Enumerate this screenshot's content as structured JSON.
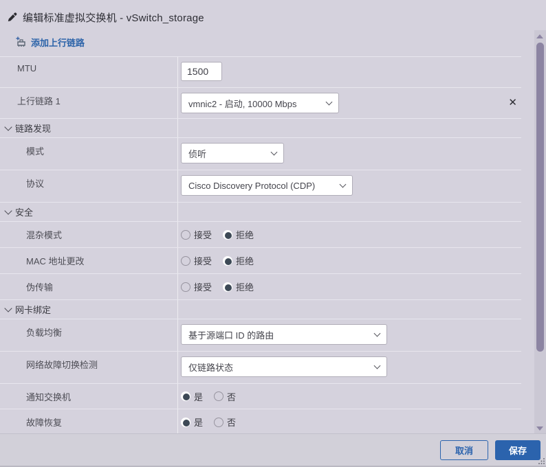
{
  "title_bar": {
    "title": "编辑标准虚拟交换机 - vSwitch_storage"
  },
  "toolbar": {
    "add_uplink_label": "添加上行链路"
  },
  "sections": {
    "link_discovery": "链路发现",
    "security": "安全",
    "nic_teaming": "网卡绑定"
  },
  "rows": {
    "mtu": {
      "label": "MTU",
      "value": "1500"
    },
    "uplink1": {
      "label": "上行链路 1",
      "value": "vmnic2 - 启动, 10000 Mbps"
    },
    "mode": {
      "label": "模式",
      "value": "侦听"
    },
    "protocol": {
      "label": "协议",
      "value": "Cisco Discovery Protocol (CDP)"
    },
    "promiscuous": {
      "label": "混杂模式",
      "accept": "接受",
      "reject": "拒绝",
      "selected": "拒绝"
    },
    "mac_changes": {
      "label": "MAC 地址更改",
      "accept": "接受",
      "reject": "拒绝",
      "selected": "拒绝"
    },
    "forged_transmits": {
      "label": "伪传输",
      "accept": "接受",
      "reject": "拒绝",
      "selected": "拒绝"
    },
    "load_balancing": {
      "label": "负载均衡",
      "value": "基于源端口 ID 的路由"
    },
    "failover_detection": {
      "label": "网络故障切换检测",
      "value": "仅链路状态"
    },
    "notify_switches": {
      "label": "通知交换机",
      "yes": "是",
      "no": "否",
      "selected": "是"
    },
    "failback": {
      "label": "故障恢复",
      "yes": "是",
      "no": "否",
      "selected": "是"
    }
  },
  "footer": {
    "cancel_label": "取消",
    "save_label": "保存"
  },
  "colors": {
    "accent_blue": "#2b63ad",
    "link_blue": "#2d64a9",
    "radio_selected": "#3d4956",
    "dialog_bg": "#d5d2dd",
    "scrollbar_thumb": "#8c84a2"
  }
}
